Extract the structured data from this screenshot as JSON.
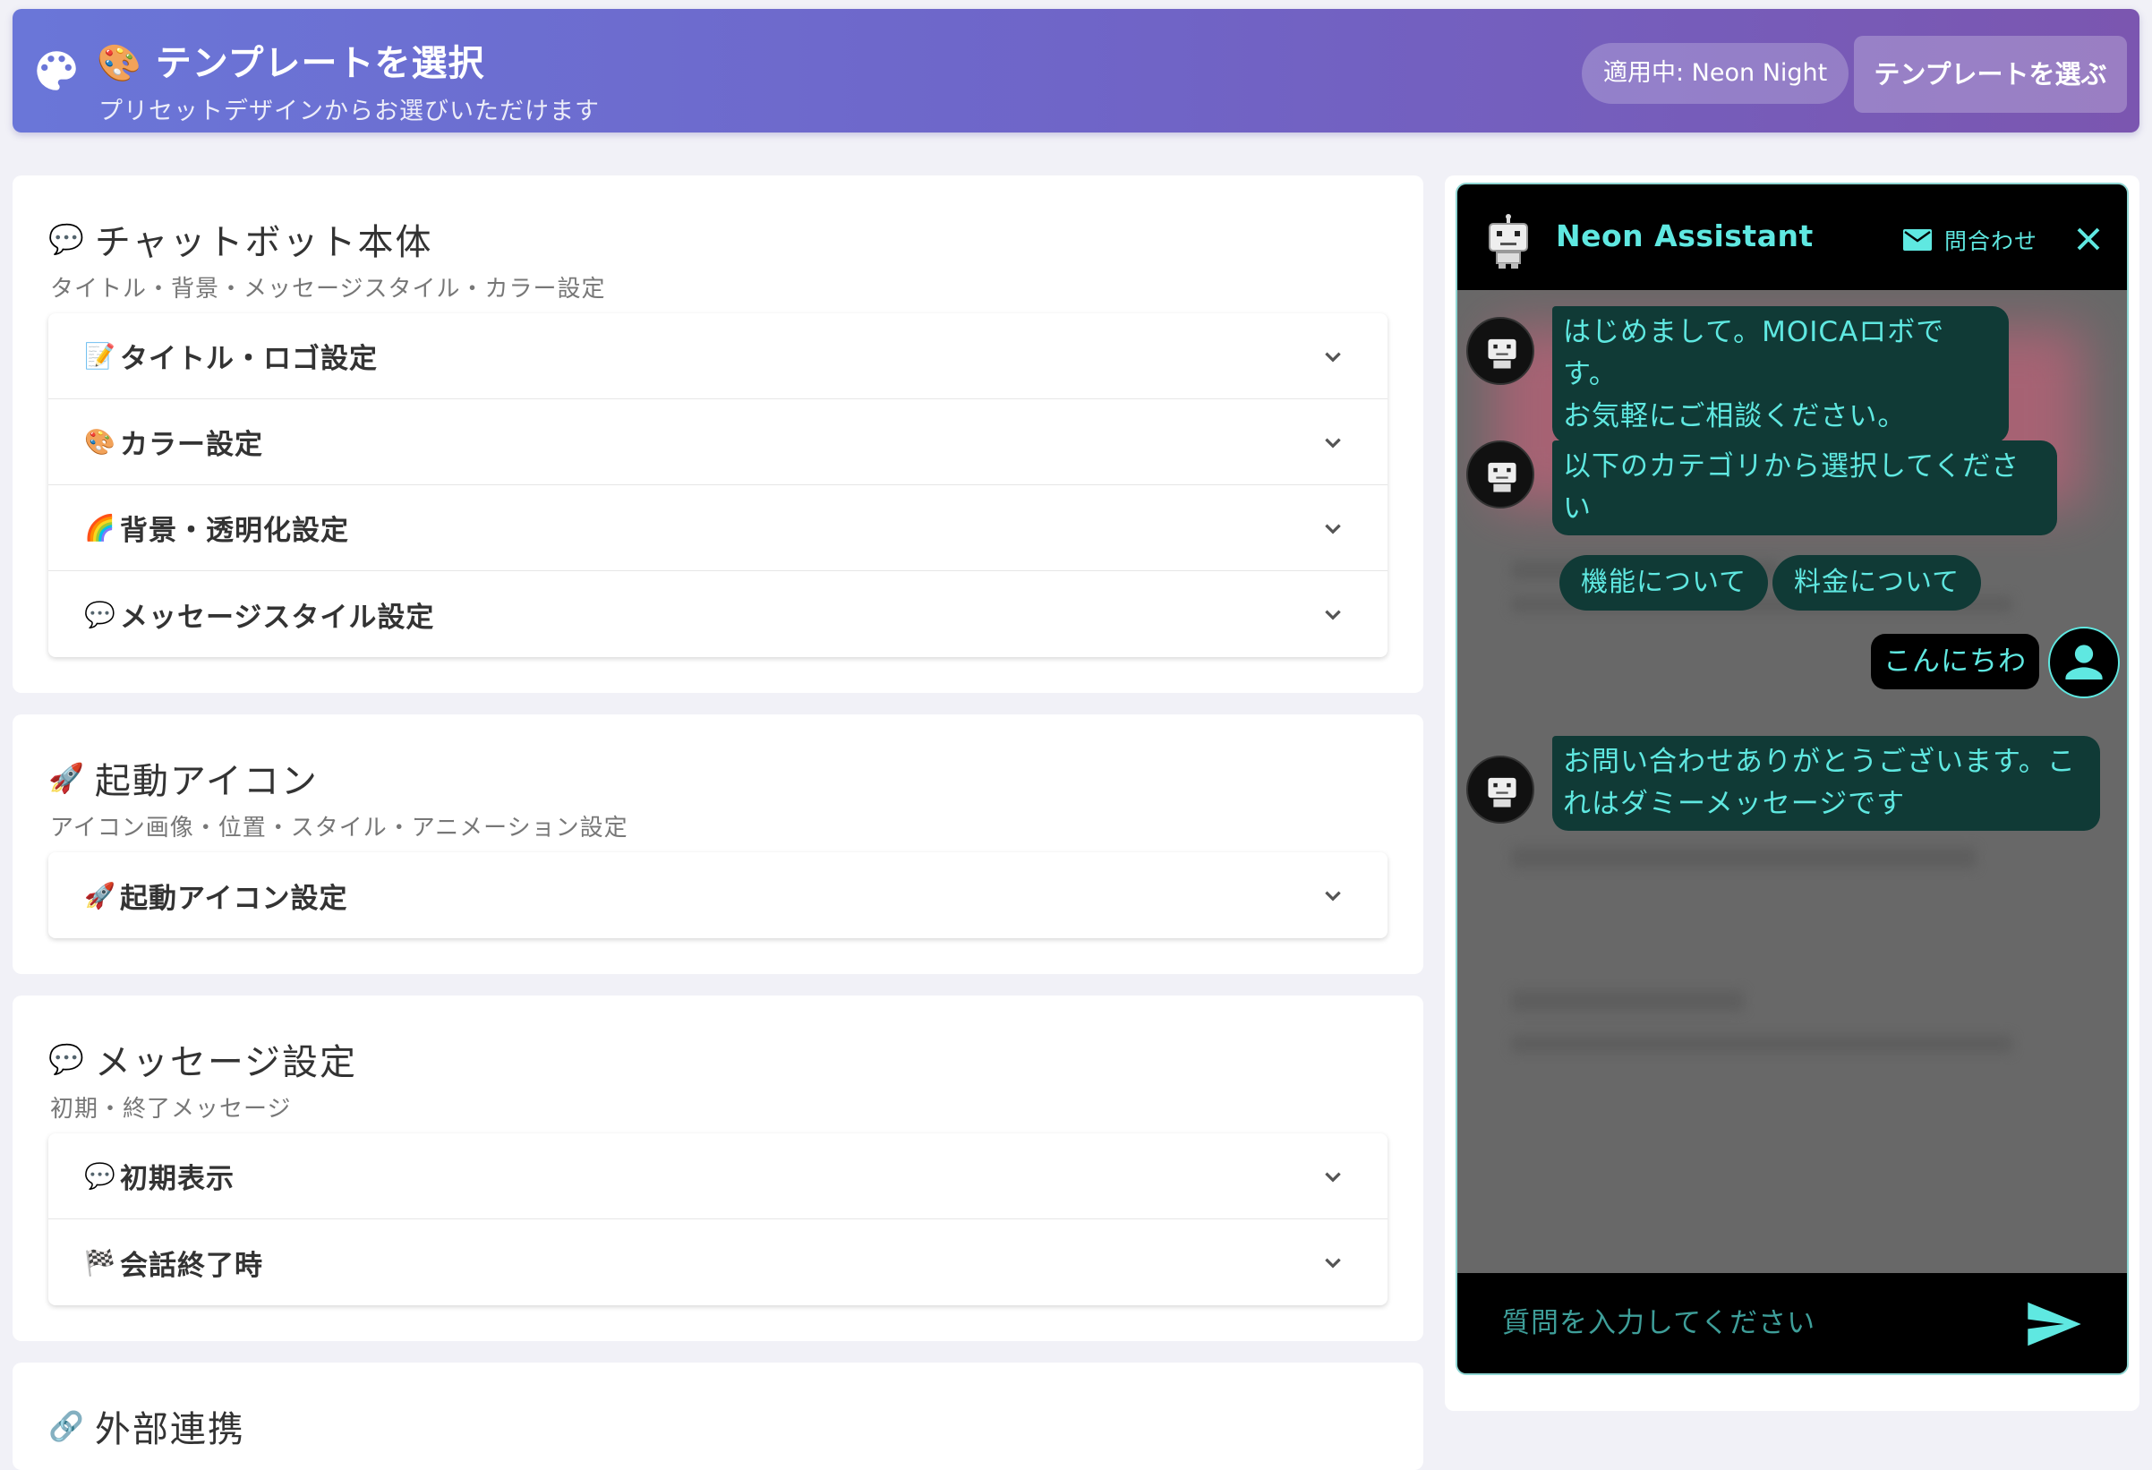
{
  "banner": {
    "emoji": "🎨",
    "title": "テンプレートを選択",
    "subtitle": "プリセットデザインからお選びいただけます",
    "applied_label": "適用中: Neon Night",
    "choose_button": "テンプレートを選ぶ"
  },
  "sections": [
    {
      "emoji": "💬",
      "title": "チャットボット本体",
      "subtitle": "タイトル・背景・メッセージスタイル・カラー設定",
      "items": [
        {
          "emoji": "📝",
          "label": "タイトル・ロゴ設定"
        },
        {
          "emoji": "🎨",
          "label": "カラー設定"
        },
        {
          "emoji": "🌈",
          "label": "背景・透明化設定"
        },
        {
          "emoji": "💬",
          "label": "メッセージスタイル設定"
        }
      ]
    },
    {
      "emoji": "🚀",
      "title": "起動アイコン",
      "subtitle": "アイコン画像・位置・スタイル・アニメーション設定",
      "items": [
        {
          "emoji": "🚀",
          "label": "起動アイコン設定"
        }
      ]
    },
    {
      "emoji": "💬",
      "title": "メッセージ設定",
      "subtitle": "初期・終了メッセージ",
      "items": [
        {
          "emoji": "💬",
          "label": "初期表示"
        },
        {
          "emoji": "🏁",
          "label": "会話終了時"
        }
      ]
    },
    {
      "emoji": "🔗",
      "title": "外部連携"
    }
  ],
  "chat": {
    "assistant_name": "Neon Assistant",
    "contact_label": "問合わせ",
    "messages": {
      "greeting_line1": "はじめまして。MOICAロボです。",
      "greeting_line2": "お気軽にご相談ください。",
      "category_prompt": "以下のカテゴリから選択してください",
      "reply_line1": "お問い合わせありがとうございます。こ",
      "reply_line2": "れはダミーメッセージです"
    },
    "quick_replies": [
      "機能について",
      "料金について"
    ],
    "user_message": "こんにちわ",
    "input_placeholder": "質問を入力してください",
    "colors": {
      "accent": "#5fe8e1",
      "bubble_bg": "#103a36",
      "header_bg": "#000000"
    }
  }
}
